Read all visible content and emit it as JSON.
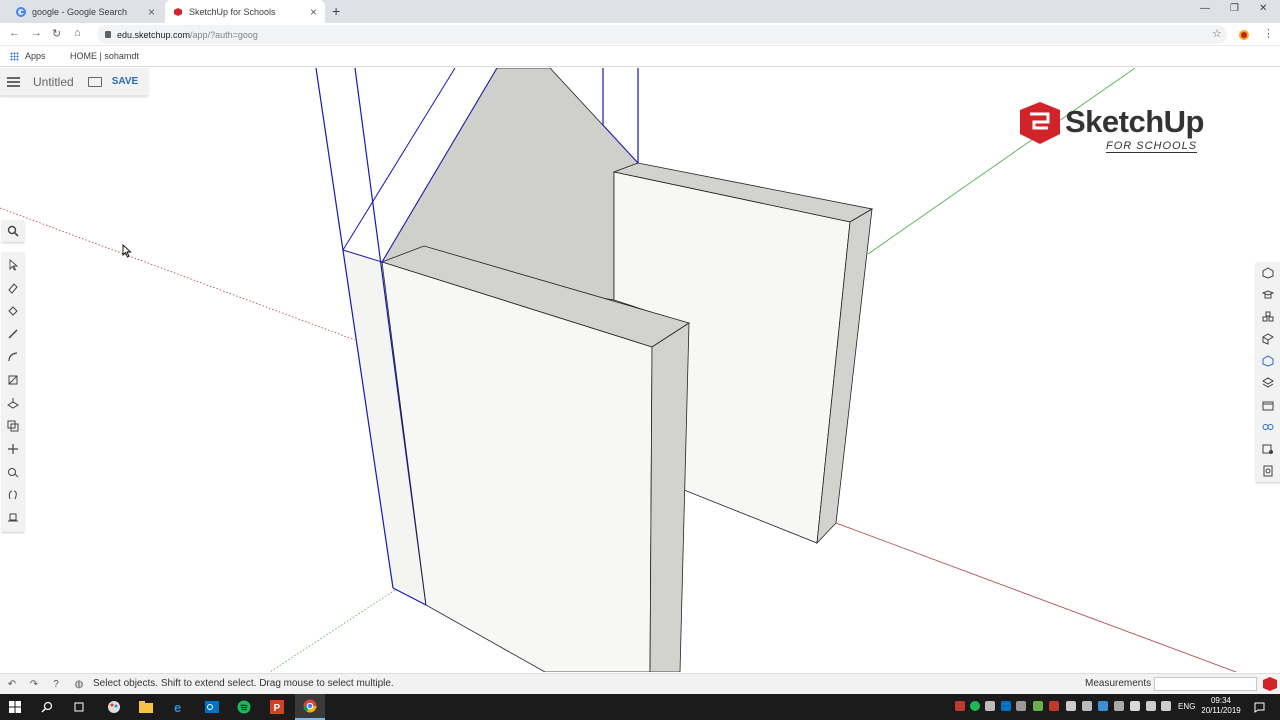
{
  "browser": {
    "tabs": [
      {
        "title": "google - Google Search",
        "active": false
      },
      {
        "title": "SketchUp for Schools",
        "active": true
      }
    ],
    "url_host": "edu.sketchup.com",
    "url_path": "/app/?auth=goog",
    "bookmarks": {
      "apps": "Apps",
      "home": "HOME | sohamdt"
    }
  },
  "app": {
    "doc_title": "Untitled",
    "save_label": "SAVE",
    "logo": {
      "word": "SketchUp",
      "sub": "FOR SCHOOLS",
      "color": "#d2232a"
    },
    "left_tools": [
      "select-icon",
      "eraser-icon",
      "paint-bucket-icon",
      "pencil-icon",
      "arc-icon",
      "rectangle-icon",
      "push-pull-icon",
      "offset-icon",
      "move-icon",
      "tape-measure-icon",
      "orbit-icon",
      "walk-icon"
    ],
    "right_tools": [
      "entity-info-icon",
      "instructor-icon",
      "components-icon",
      "materials-icon",
      "styles-icon",
      "layers-icon",
      "scenes-icon",
      "display-icon",
      "3d-warehouse-icon",
      "extensions-icon"
    ],
    "accent": "#2b6db5",
    "axis_colors": {
      "red": "#b03a3a",
      "green": "#3fae3f",
      "blue": "#2222cc"
    }
  },
  "status": {
    "message": "Select objects. Shift to extend select. Drag mouse to select multiple.",
    "measurements_label": "Measurements",
    "measurements_value": ""
  },
  "taskbar": {
    "lang": "ENG",
    "time": "09:34",
    "date": "20/11/2019"
  }
}
